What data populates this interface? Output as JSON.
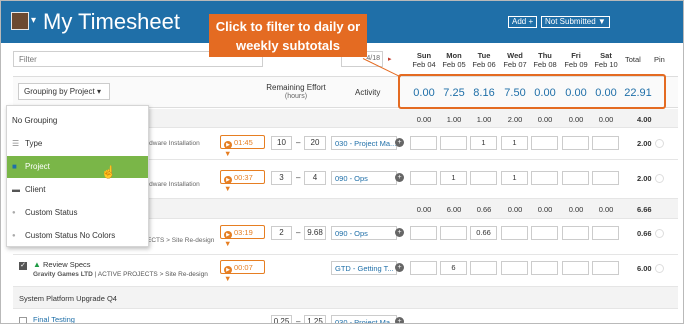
{
  "app": {
    "title": "My Timesheet",
    "add_button": "Add +",
    "status_button": "Not Submitted ▼"
  },
  "filter": {
    "placeholder": "Filter"
  },
  "date_nav": {
    "date_fragment": "4/18",
    "next_symbol": "▸"
  },
  "days": [
    {
      "name": "Sun",
      "date": "Feb 04"
    },
    {
      "name": "Mon",
      "date": "Feb 05"
    },
    {
      "name": "Tue",
      "date": "Feb 06"
    },
    {
      "name": "Wed",
      "date": "Feb 07"
    },
    {
      "name": "Thu",
      "date": "Feb 08"
    },
    {
      "name": "Fri",
      "date": "Feb 09"
    },
    {
      "name": "Sat",
      "date": "Feb 10"
    }
  ],
  "columns": {
    "total": "Total",
    "pin": "Pin",
    "remaining_effort": "Remaining Effort",
    "remaining_unit": "(hours)",
    "activity": "Activity"
  },
  "grouping": {
    "button_label": "Grouping by Project"
  },
  "subtotals": [
    "0.00",
    "7.25",
    "8.16",
    "7.50",
    "0.00",
    "0.00",
    "0.00",
    "22.91"
  ],
  "callout": {
    "line1": "Click to filter to daily or",
    "line2": "weekly subtotals"
  },
  "dropdown_options": [
    {
      "label": "No Grouping",
      "icon": ""
    },
    {
      "label": "Type",
      "icon": "list-icon"
    },
    {
      "label": "Project",
      "icon": "folder-icon"
    },
    {
      "label": "Client",
      "icon": "briefcase-icon"
    },
    {
      "label": "Custom Status",
      "icon": "dot-icon"
    },
    {
      "label": "Custom Status No Colors",
      "icon": "dot-icon"
    }
  ],
  "group1": {
    "values": [
      "0.00",
      "1.00",
      "1.00",
      "2.00",
      "0.00",
      "0.00",
      "0.00"
    ],
    "total": "4.00"
  },
  "task1": {
    "sub": "rdware Installation",
    "timer": "01:45 ▼",
    "rem_low": "10",
    "rem_high": "20",
    "activity": "030 - Project Ma...",
    "hours": [
      "",
      "",
      "1",
      "1",
      "",
      "",
      ""
    ],
    "total": "2.00"
  },
  "task2": {
    "sub": "rdware Installation",
    "timer": "00:37 ▼",
    "rem_low": "3",
    "rem_high": "4",
    "activity": "090 - Ops",
    "hours": [
      "",
      "1",
      "",
      "1",
      "",
      "",
      ""
    ],
    "total": "2.00"
  },
  "group2": {
    "values": [
      "0.00",
      "6.00",
      "0.66",
      "0.00",
      "0.00",
      "0.00",
      "0.00"
    ],
    "total": "6.66"
  },
  "task3": {
    "sub": "ECTS > Site Re-design",
    "timer": "03:19 ▼",
    "rem_low": "2",
    "rem_high": "9.68",
    "activity": "090 - Ops",
    "hours": [
      "",
      "",
      "0.66",
      "",
      "",
      "",
      ""
    ],
    "total": "0.66"
  },
  "task4": {
    "title": "Review Specs",
    "client": "Gravity Games LTD",
    "path": "| ACTIVE PROJECTS > Site Re-design",
    "timer": "00:07 ▼",
    "activity": "GTD - Getting T...",
    "hours": [
      "",
      "6",
      "",
      "",
      "",
      "",
      ""
    ],
    "total": "6.00"
  },
  "group3": {
    "title": "System Platform Upgrade Q4"
  },
  "task5": {
    "title": "Final Testing",
    "rem_low": "0.25",
    "rem_high": "1.25",
    "activity": "030 - Project Ma..."
  }
}
